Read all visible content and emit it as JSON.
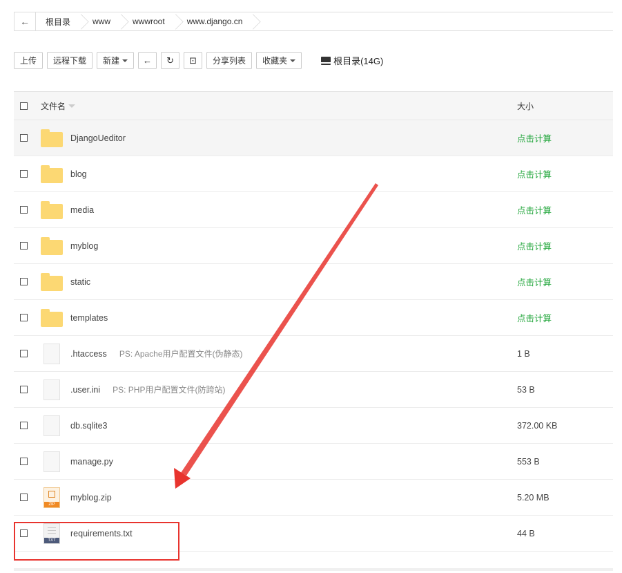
{
  "breadcrumb": {
    "back_icon": "←",
    "items": [
      "根目录",
      "www",
      "wwwroot",
      "www.django.cn"
    ]
  },
  "toolbar": {
    "upload": "上传",
    "remote_download": "远程下载",
    "new": "新建",
    "back_icon": "←",
    "refresh_icon": "↻",
    "terminal_icon": "⊡",
    "share_list": "分享列表",
    "favorites": "收藏夹",
    "disk_label": "根目录(14G)"
  },
  "table": {
    "col_name": "文件名",
    "col_size": "大小",
    "rows": [
      {
        "type": "folder",
        "name": "DjangoUeditor",
        "remark": "",
        "size": "点击计算"
      },
      {
        "type": "folder",
        "name": "blog",
        "remark": "",
        "size": "点击计算"
      },
      {
        "type": "folder",
        "name": "media",
        "remark": "",
        "size": "点击计算"
      },
      {
        "type": "folder",
        "name": "myblog",
        "remark": "",
        "size": "点击计算"
      },
      {
        "type": "folder",
        "name": "static",
        "remark": "",
        "size": "点击计算"
      },
      {
        "type": "folder",
        "name": "templates",
        "remark": "",
        "size": "点击计算"
      },
      {
        "type": "file",
        "name": ".htaccess",
        "remark": "PS: Apache用户配置文件(伪静态)",
        "size": "1 B"
      },
      {
        "type": "file",
        "name": ".user.ini",
        "remark": "PS: PHP用户配置文件(防跨站)",
        "size": "53 B"
      },
      {
        "type": "file",
        "name": "db.sqlite3",
        "remark": "",
        "size": "372.00 KB"
      },
      {
        "type": "file",
        "name": "manage.py",
        "remark": "",
        "size": "553 B"
      },
      {
        "type": "zip",
        "name": "myblog.zip",
        "remark": "",
        "size": "5.20 MB"
      },
      {
        "type": "txt",
        "name": "requirements.txt",
        "remark": "",
        "size": "44 B"
      }
    ]
  },
  "icon_labels": {
    "zip": "ZIP",
    "txt": "TXT"
  },
  "colors": {
    "accent_green": "#20a53a",
    "annotation_red": "#e8342e",
    "folder": "#fcd873"
  }
}
